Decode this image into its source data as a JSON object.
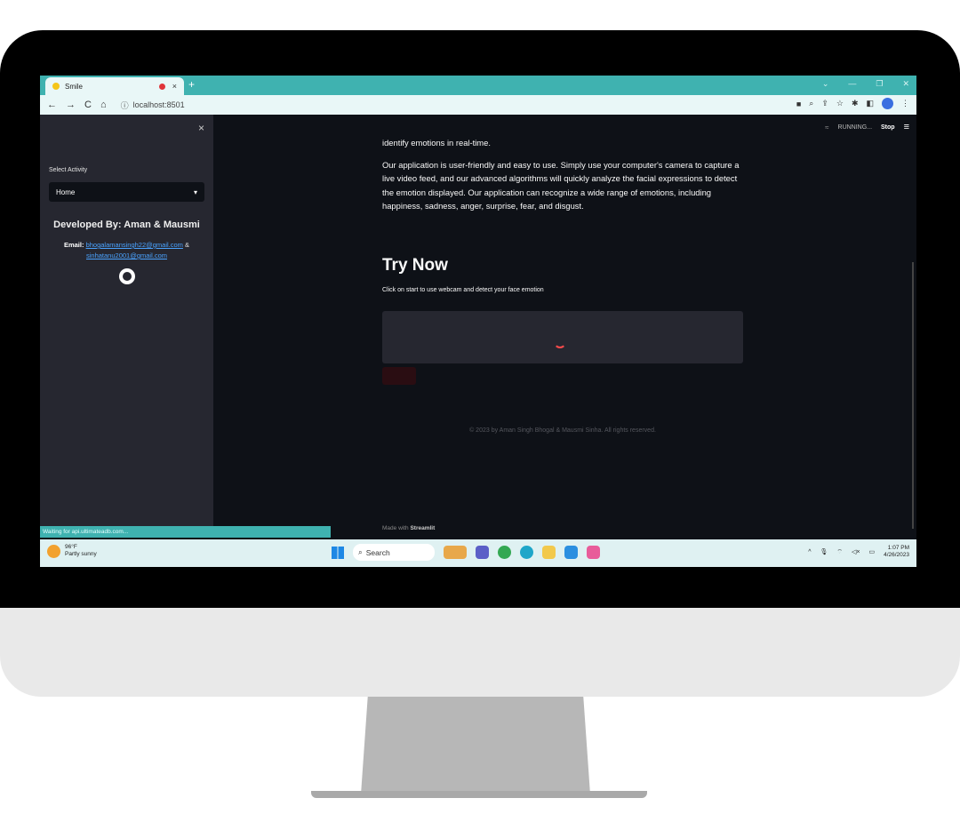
{
  "browser": {
    "tab_title": "Smile",
    "url": "localhost:8501",
    "new_tab": "+",
    "nav": {
      "back": "←",
      "forward": "→",
      "reload": "C",
      "home": "⌂"
    }
  },
  "sidebar": {
    "close": "×",
    "select_label": "Select Activity",
    "select_value": "Home",
    "heading": "Developed By: Aman & Mausmi",
    "email_label": "Email:",
    "email_1": "bhogalamansingh22@gmail.com",
    "email_sep": "&",
    "email_2": "sinhatanu2001@gmail.com",
    "github_icon": "github-icon"
  },
  "toolbar": {
    "status": "RUNNING...",
    "stop": "Stop",
    "menu": "≡"
  },
  "main": {
    "intro_cut": "identify emotions in real-time.",
    "paragraph": "Our application is user-friendly and easy to use. Simply use your computer's camera to capture a live video feed, and our advanced algorithms will quickly analyze the facial expressions to detect the emotion displayed. Our application can recognize a wide range of emotions, including happiness, sadness, anger, surprise, fear, and disgust.",
    "try_now": "Try Now",
    "try_sub": "Click on start to use webcam and detect your face emotion",
    "footer": "© 2023 by Aman Singh Bhogal & Mausmi Sinha. All rights reserved.",
    "made_with": "Made with",
    "made_with_brand": "Streamlit"
  },
  "status_bar": "Waiting for api.ultimateadb.com...",
  "taskbar": {
    "temp": "96°F",
    "weather": "Partly sunny",
    "search": "Search",
    "time": "1:07 PM",
    "date": "4/26/2023"
  },
  "colors": {
    "accent": "#3fb2b0",
    "app_bg": "#0e1117",
    "sidebar_bg": "#262730",
    "primary": "#ff4b4b"
  }
}
